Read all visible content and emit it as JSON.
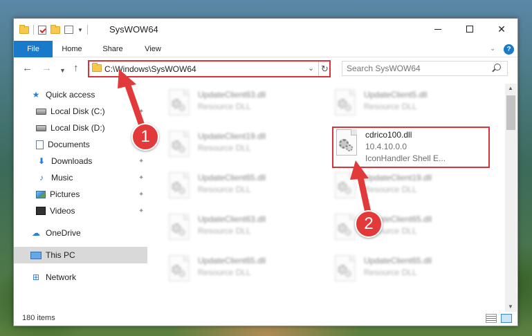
{
  "window": {
    "title": "SysWOW64",
    "ribbon_tabs": [
      "File",
      "Home",
      "Share",
      "View"
    ],
    "help": "?"
  },
  "navigation": {
    "address": "C:\\Windows\\SysWOW64",
    "search_placeholder": "Search SysWOW64"
  },
  "sidebar": {
    "items": [
      {
        "label": "Quick access",
        "icon": "star-icon"
      },
      {
        "label": "Local Disk (C:)",
        "icon": "drive-icon"
      },
      {
        "label": "Local Disk (D:)",
        "icon": "drive-icon"
      },
      {
        "label": "Documents",
        "icon": "documents-icon"
      },
      {
        "label": "Downloads",
        "icon": "download-icon"
      },
      {
        "label": "Music",
        "icon": "music-icon"
      },
      {
        "label": "Pictures",
        "icon": "pictures-icon"
      },
      {
        "label": "Videos",
        "icon": "videos-icon"
      },
      {
        "label": "OneDrive",
        "icon": "cloud-icon"
      },
      {
        "label": "This PC",
        "icon": "computer-icon"
      },
      {
        "label": "Network",
        "icon": "network-icon"
      }
    ]
  },
  "files": [
    {
      "name": "UpdateClient63.dll",
      "sub": "Resource DLL"
    },
    {
      "name": "UpdateClient5.dll",
      "sub": "Resource DLL"
    },
    {
      "name": "UpdateClient19.dll",
      "sub": "Resource DLL"
    },
    {
      "name": "cdrico100.dll",
      "version": "10.4.10.0.0",
      "description": "IconHandler Shell E..."
    },
    {
      "name": "UpdateClient65.dll",
      "sub": "Resource DLL"
    },
    {
      "name": "UpdateClient19.dll",
      "sub": "Resource DLL"
    },
    {
      "name": "UpdateClient63.dll",
      "sub": "Resource DLL"
    },
    {
      "name": "UpdateClient65.dll",
      "sub": "Resource DLL"
    },
    {
      "name": "UpdateClient65.dll",
      "sub": "Resource DLL"
    },
    {
      "name": "UpdateClient65.dll",
      "sub": "Resource DLL"
    }
  ],
  "status": {
    "item_count": "180 items"
  },
  "callouts": {
    "one": "1",
    "two": "2"
  },
  "colors": {
    "accent": "#1979ca",
    "highlight": "#d9323a",
    "callout": "#e23a3a"
  }
}
